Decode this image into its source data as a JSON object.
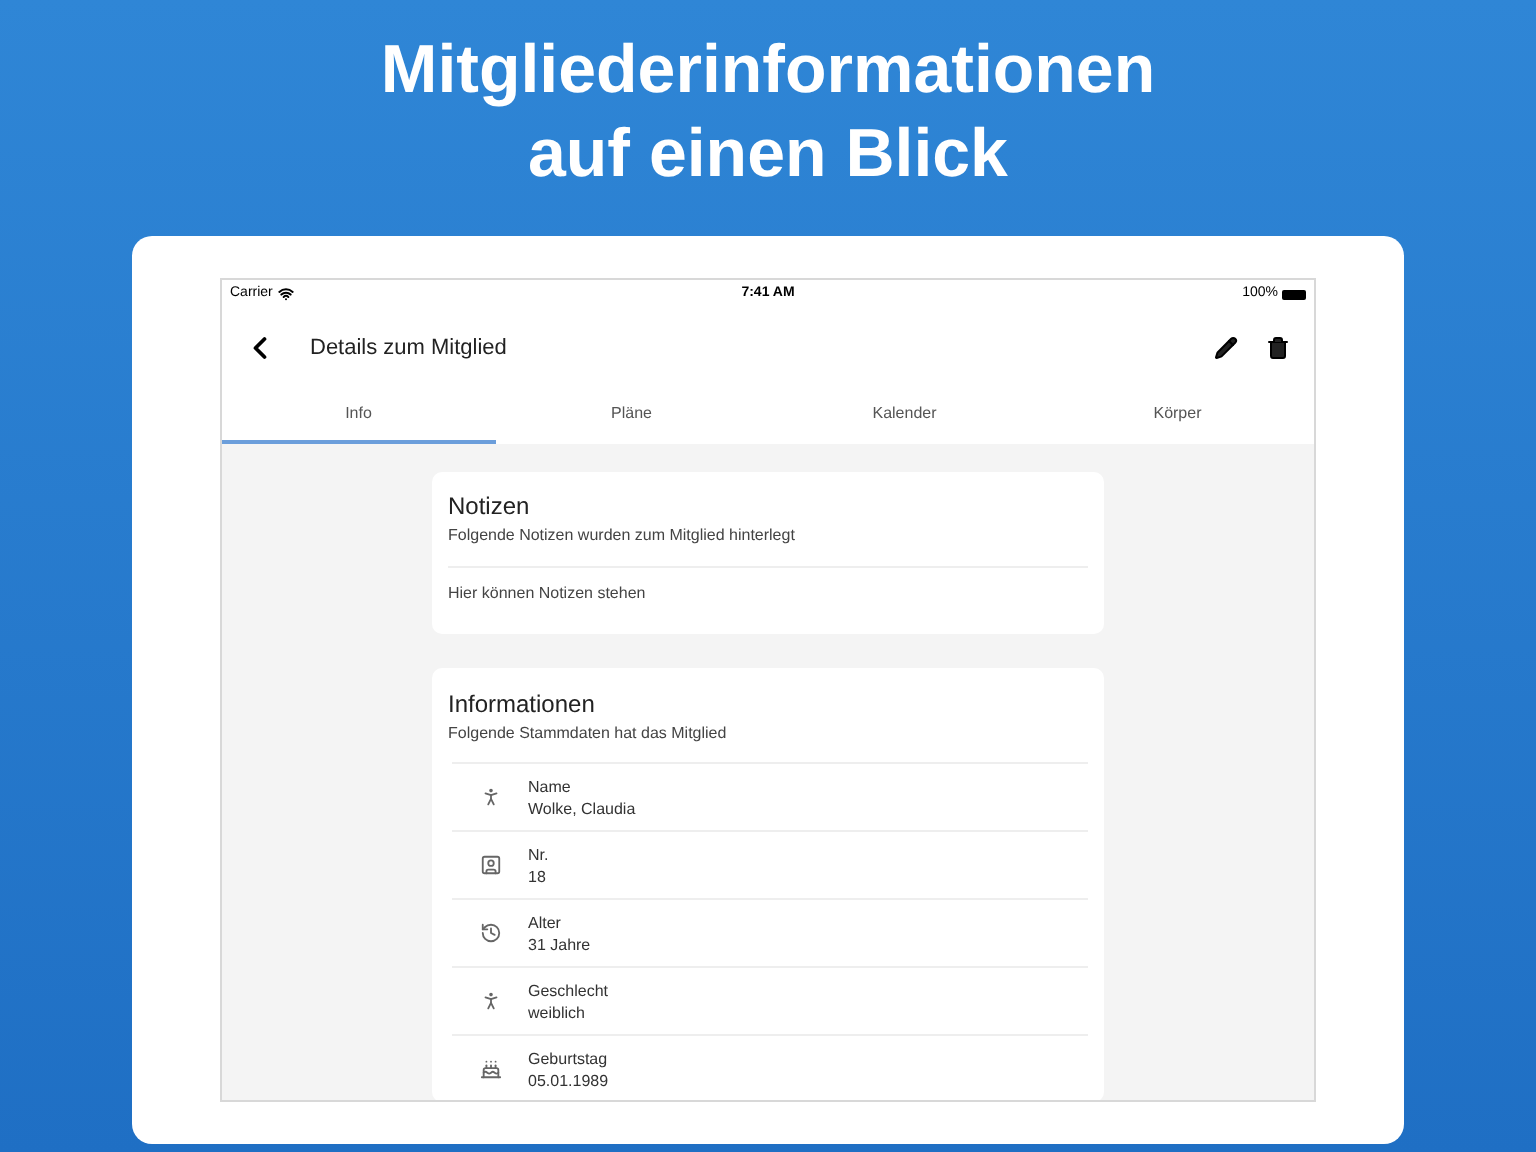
{
  "headline": [
    "Mitgliederinformationen",
    "auf einen Blick"
  ],
  "status_bar": {
    "carrier": "Carrier",
    "time": "7:41 AM",
    "battery": "100%"
  },
  "toolbar": {
    "title": "Details zum Mitglied"
  },
  "tabs": [
    {
      "label": "Info",
      "selected": true
    },
    {
      "label": "Pläne",
      "selected": false
    },
    {
      "label": "Kalender",
      "selected": false
    },
    {
      "label": "Körper",
      "selected": false
    }
  ],
  "notes_card": {
    "title": "Notizen",
    "subtitle": "Folgende Notizen wurden zum Mitglied hinterlegt",
    "text": "Hier können Notizen stehen"
  },
  "info_card": {
    "title": "Informationen",
    "subtitle": "Folgende Stammdaten hat das Mitglied",
    "rows": [
      {
        "kind": "person",
        "label": "Name",
        "value": "Wolke, Claudia"
      },
      {
        "kind": "id",
        "label": "Nr.",
        "value": "18"
      },
      {
        "kind": "age",
        "label": "Alter",
        "value": "31 Jahre"
      },
      {
        "kind": "person",
        "label": "Geschlecht",
        "value": "weiblich"
      },
      {
        "kind": "birthday",
        "label": "Geburtstag",
        "value": "05.01.1989"
      }
    ]
  }
}
